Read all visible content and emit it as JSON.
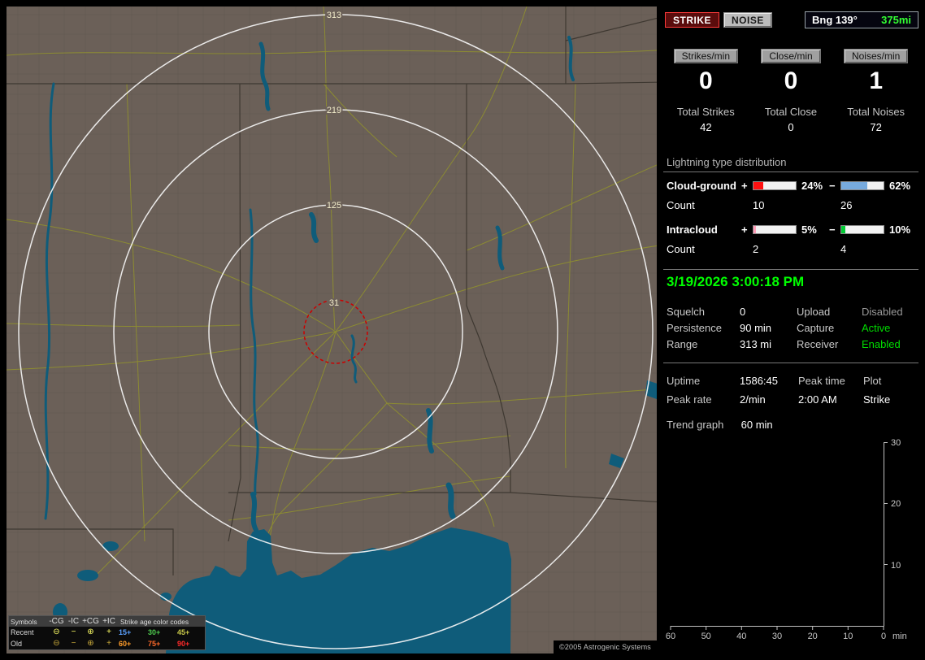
{
  "map": {
    "ring_labels": [
      "313",
      "219",
      "125",
      "31"
    ],
    "copyright": "©2005 Astrogenic Systems",
    "colors": {
      "land": "#6b6058",
      "water": "#0f5c7a",
      "road": "#8e8e30",
      "state_border": "#3e3831",
      "range_ring": "#f5f5f5",
      "alert_ring": "#cc0000",
      "ring_label": "#f2ecca"
    },
    "legend": {
      "symbols_header": "Symbols",
      "symbol_cols": [
        "-CG",
        "-IC",
        "+CG",
        "+IC"
      ],
      "age_header": "Strike age color codes",
      "rows": [
        {
          "label": "Recent",
          "symbols": [
            "⊖",
            "−",
            "⊕",
            "+"
          ],
          "symbol_color": "#ffff66",
          "ages": [
            {
              "text": "15+",
              "color": "#5aa0ff"
            },
            {
              "text": "30+",
              "color": "#4ec94e"
            },
            {
              "text": "45+",
              "color": "#c9c94a"
            }
          ]
        },
        {
          "label": "Old",
          "symbols": [
            "⊖",
            "−",
            "⊕",
            "+"
          ],
          "symbol_color": "#c9a93a",
          "ages": [
            {
              "text": "60+",
              "color": "#ff9c2a"
            },
            {
              "text": "75+",
              "color": "#ff6a2a"
            },
            {
              "text": "90+",
              "color": "#ff2a2a"
            }
          ]
        }
      ]
    }
  },
  "sidebar": {
    "strike_button": "STRIKE",
    "noise_button": "NOISE",
    "bearing": {
      "label": "Bng 139°",
      "range": "375mi",
      "range_color": "#33ff33"
    },
    "counters": [
      {
        "label": "Strikes/min",
        "value": "0",
        "total_label": "Total Strikes",
        "total": "42"
      },
      {
        "label": "Close/min",
        "value": "0",
        "total_label": "Total Close",
        "total": "0"
      },
      {
        "label": "Noises/min",
        "value": "1",
        "total_label": "Total Noises",
        "total": "72"
      }
    ],
    "distribution": {
      "title": "Lightning type distribution",
      "rows": [
        {
          "label": "Cloud-ground",
          "plus_sign": "+",
          "minus_sign": "−",
          "plus_pct": "24%",
          "minus_pct": "62%",
          "plus_fill": 24,
          "minus_fill": 62,
          "plus_color": "#ff1111",
          "minus_color": "#77aadd",
          "count_label": "Count",
          "plus_count": "10",
          "minus_count": "26"
        },
        {
          "label": "Intracloud",
          "plus_sign": "+",
          "minus_sign": "−",
          "plus_pct": "5%",
          "minus_pct": "10%",
          "plus_fill": 5,
          "minus_fill": 10,
          "plus_color": "#ff9db8",
          "minus_color": "#00cc33",
          "count_label": "Count",
          "plus_count": "2",
          "minus_count": "4"
        }
      ]
    },
    "timestamp": "3/19/2026 3:00:18 PM",
    "status_rows": [
      {
        "label": "Squelch",
        "value": "0",
        "label2": "Upload",
        "value2": "Disabled",
        "value2_color": "#9a9a9a"
      },
      {
        "label": "Persistence",
        "value": "90 min",
        "label2": "Capture",
        "value2": "Active",
        "value2_color": "#00dd00"
      },
      {
        "label": "Range",
        "value": "313 mi",
        "label2": "Receiver",
        "value2": "Enabled",
        "value2_color": "#00dd00"
      }
    ],
    "stats": {
      "uptime_label": "Uptime",
      "uptime": "1586:45",
      "peak_rate_label": "Peak rate",
      "peak_rate": "2/min",
      "peak_time_label": "Peak time",
      "peak_time": "2:00 AM",
      "plot_label": "Plot",
      "plot": "Strike"
    },
    "trend": {
      "label": "Trend graph",
      "window": "60 min",
      "x_ticks": [
        "60",
        "50",
        "40",
        "30",
        "20",
        "10",
        "0"
      ],
      "x_unit": "min",
      "y_ticks": [
        "30",
        "20",
        "10"
      ]
    }
  }
}
